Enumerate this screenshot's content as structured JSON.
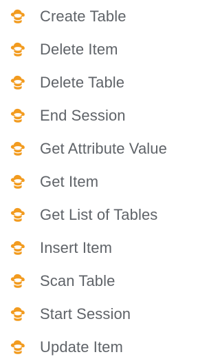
{
  "items": [
    {
      "label": "Create Table",
      "icon": "cloud-database-icon"
    },
    {
      "label": "Delete Item",
      "icon": "cloud-database-icon"
    },
    {
      "label": "Delete Table",
      "icon": "cloud-database-icon"
    },
    {
      "label": "End Session",
      "icon": "cloud-database-icon"
    },
    {
      "label": "Get Attribute Value",
      "icon": "cloud-database-icon"
    },
    {
      "label": "Get Item",
      "icon": "cloud-database-icon"
    },
    {
      "label": "Get List of Tables",
      "icon": "cloud-database-icon"
    },
    {
      "label": "Insert Item",
      "icon": "cloud-database-icon"
    },
    {
      "label": "Scan Table",
      "icon": "cloud-database-icon"
    },
    {
      "label": "Start Session",
      "icon": "cloud-database-icon"
    },
    {
      "label": "Update Item",
      "icon": "cloud-database-icon"
    }
  ],
  "colors": {
    "icon_orange": "#f29b1f",
    "text_gray": "#5f6368"
  }
}
